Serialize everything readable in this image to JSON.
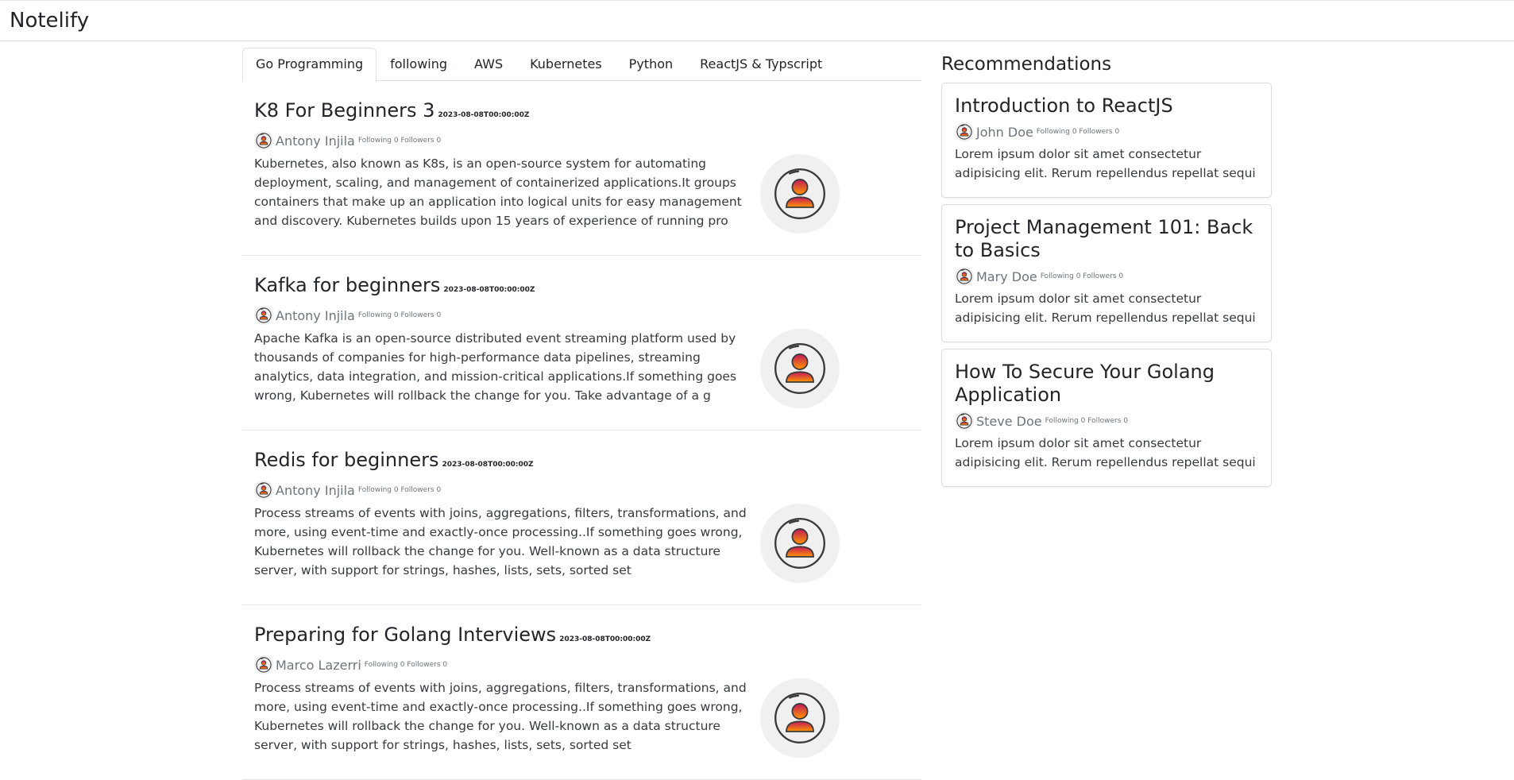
{
  "navbar": {
    "brand": "Notelify"
  },
  "tabs": [
    {
      "label": "Go Programming",
      "active": true
    },
    {
      "label": "following",
      "active": false
    },
    {
      "label": "AWS",
      "active": false
    },
    {
      "label": "Kubernetes",
      "active": false
    },
    {
      "label": "Python",
      "active": false
    },
    {
      "label": "ReactJS & Typscript",
      "active": false
    }
  ],
  "articles": [
    {
      "title": "K8 For Beginners 3",
      "date": "2023-08-08T00:00:00Z",
      "author": "Antony Injila",
      "follow_info": "Following 0 Followers 0",
      "summary": "Kubernetes, also known as K8s, is an open-source system for automating deployment, scaling, and management of containerized applications.It groups containers that make up an application into logical units for easy management and discovery. Kubernetes builds upon 15 years of experience of running pro"
    },
    {
      "title": "Kafka for beginners",
      "date": "2023-08-08T00:00:00Z",
      "author": "Antony Injila",
      "follow_info": "Following 0 Followers 0",
      "summary": "Apache Kafka is an open-source distributed event streaming platform used by thousands of companies for high-performance data pipelines, streaming analytics, data integration, and mission-critical applications.If something goes wrong, Kubernetes will rollback the change for you. Take advantage of a g"
    },
    {
      "title": "Redis for beginners",
      "date": "2023-08-08T00:00:00Z",
      "author": "Antony Injila",
      "follow_info": "Following 0 Followers 0",
      "summary": "Process streams of events with joins, aggregations, filters, transformations, and more, using event-time and exactly-once processing..If something goes wrong, Kubernetes will rollback the change for you. Well-known as a data structure server, with support for strings, hashes, lists, sets, sorted set"
    },
    {
      "title": "Preparing for Golang Interviews",
      "date": "2023-08-08T00:00:00Z",
      "author": "Marco Lazerri",
      "follow_info": "Following 0 Followers 0",
      "summary": "Process streams of events with joins, aggregations, filters, transformations, and more, using event-time and exactly-once processing..If something goes wrong, Kubernetes will rollback the change for you. Well-known as a data structure server, with support for strings, hashes, lists, sets, sorted set"
    }
  ],
  "recommendations": {
    "heading": "Recommendations",
    "items": [
      {
        "title": "Introduction to ReactJS",
        "author": "John Doe",
        "follow_info": "Following 0 Followers 0",
        "text": "Lorem ipsum dolor sit amet consectetur adipisicing elit. Rerum repellendus repellat sequi"
      },
      {
        "title": "Project Management 101: Back to Basics",
        "author": "Mary Doe",
        "follow_info": "Following 0 Followers 0",
        "text": "Lorem ipsum dolor sit amet consectetur adipisicing elit. Rerum repellendus repellat sequi"
      },
      {
        "title": "How To Secure Your Golang Application",
        "author": "Steve Doe",
        "follow_info": "Following 0 Followers 0",
        "text": "Lorem ipsum dolor sit amet consectetur adipisicing elit. Rerum repellendus repellat sequi"
      }
    ]
  },
  "icons": {
    "avatar": "user-avatar-icon"
  },
  "colors": {
    "avatar_gradient_top": "#c2185b",
    "avatar_gradient_bottom": "#ff9800"
  }
}
